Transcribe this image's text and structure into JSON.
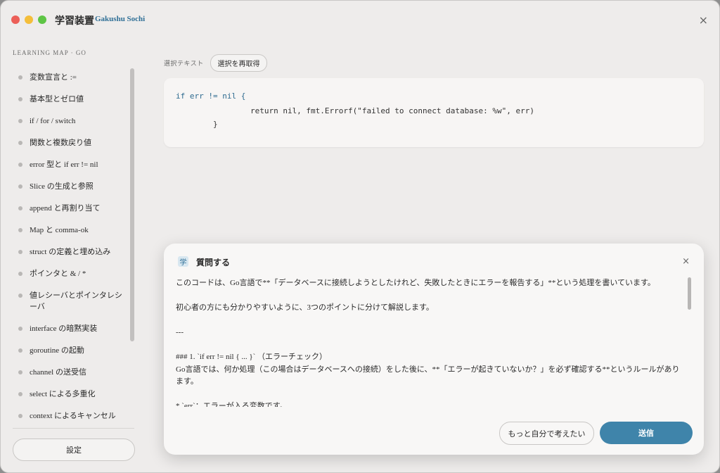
{
  "app": {
    "title": "学習装置",
    "subtitle": "Gakushu Sochi"
  },
  "sidebar": {
    "heading": "LEARNING MAP · GO",
    "items": [
      {
        "label": "変数宣言と :="
      },
      {
        "label": "基本型とゼロ値"
      },
      {
        "label": "if / for / switch"
      },
      {
        "label": "関数と複数戻り値"
      },
      {
        "label": "error 型と if err != nil"
      },
      {
        "label": "Slice の生成と参照"
      },
      {
        "label": "append と再割り当て"
      },
      {
        "label": "Map と comma-ok"
      },
      {
        "label": "struct の定義と埋め込み"
      },
      {
        "label": "ポインタと & / *"
      },
      {
        "label": "値レシーバとポインタレシーバ"
      },
      {
        "label": "interface の暗黙実装"
      },
      {
        "label": "goroutine の起動"
      },
      {
        "label": "channel の送受信"
      },
      {
        "label": "select による多重化"
      },
      {
        "label": "context によるキャンセル"
      }
    ],
    "settings_label": "設定"
  },
  "selection": {
    "label": "選択テキスト",
    "refetch_label": "選択を再取得",
    "code": {
      "line1": "if err != nil {",
      "line2": "                return nil, fmt.Errorf(\"failed to connect database: %w\", err)",
      "line3": "        }"
    }
  },
  "ask": {
    "icon_char": "学",
    "title": "質問する",
    "answer": {
      "p1": "このコードは、Go言語で**「データベースに接続しようとしたけれど、失敗したときにエラーを報告する」**という処理を書いています。",
      "p2": "初心者の方にも分かりやすいように、3つのポイントに分けて解説します。",
      "p3": "---",
      "p4": "### 1. `if err != nil { ... }` （エラーチェック）",
      "p5": "Go言語では、何か処理（この場合はデータベースへの接続）をした後に、**「エラーが起きていないか？」を必ず確認する**というルールがあります。",
      "p6": "*  `err`：エラーが入る変数です。"
    },
    "think_label": "もっと自分で考えたい",
    "send_label": "送信"
  },
  "colors": {
    "accent": "#3f84aa",
    "close_red": "#ec5f58",
    "minimize_yellow": "#f4be3a",
    "zoom_green": "#5ec545"
  }
}
